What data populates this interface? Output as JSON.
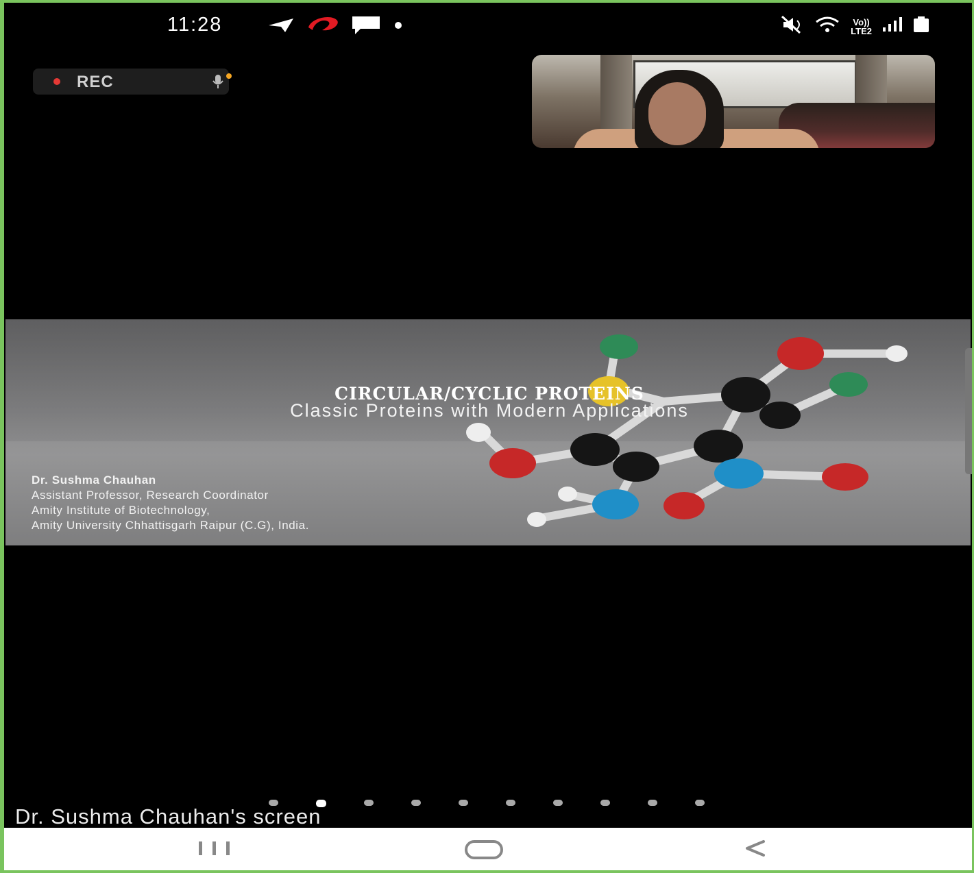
{
  "status_bar": {
    "time": "11:28",
    "left_icons": [
      "telegram-icon",
      "airtel-icon",
      "message-icon",
      "notification-dot-icon"
    ],
    "right_icons": [
      "mute-icon",
      "wifi-icon",
      "volte-lte2-icon",
      "signal-icon",
      "battery-icon"
    ],
    "network_label_top": "Vo))",
    "network_label_bottom": "LTE2"
  },
  "recording": {
    "label": "REC",
    "mic_icon": "microphone-icon",
    "dot_color": "#e53935"
  },
  "self_view": {
    "icon": "participant-video-thumbnail"
  },
  "slide": {
    "title": "CIRCULAR/CYCLIC PROTEINS",
    "subtitle": "Classic Proteins with Modern Applications",
    "presenter_name": "Dr. Sushma Chauhan",
    "presenter_role": "Assistant Professor, Research Coordinator",
    "presenter_institute": "Amity Institute of Biotechnology,",
    "presenter_university": "Amity University Chhattisgarh Raipur (C.G), India."
  },
  "pager": {
    "count": 10,
    "active_index": 1
  },
  "screen_share_caption": "Dr. Sushma Chauhan's screen",
  "nav_bar": {
    "recents_icon": "recents-icon",
    "home_icon": "home-icon",
    "back_icon": "back-icon"
  },
  "colors": {
    "frame_border": "#7ac45e",
    "background": "#000000",
    "rec_dot": "#e53935"
  }
}
